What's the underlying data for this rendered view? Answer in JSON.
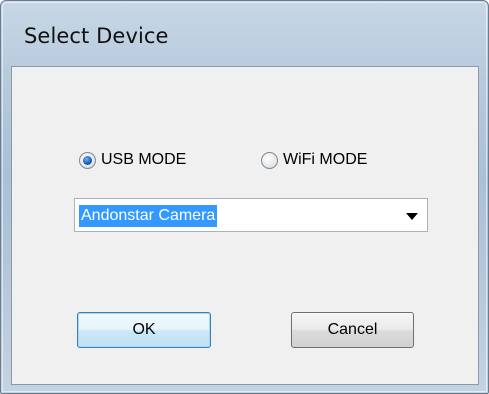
{
  "window": {
    "title": "Select Device"
  },
  "mode": {
    "usb_label": "USB MODE",
    "wifi_label": "WiFi MODE",
    "selected": "usb"
  },
  "device_select": {
    "value": "Andonstar Camera"
  },
  "buttons": {
    "ok_label": "OK",
    "cancel_label": "Cancel"
  }
}
